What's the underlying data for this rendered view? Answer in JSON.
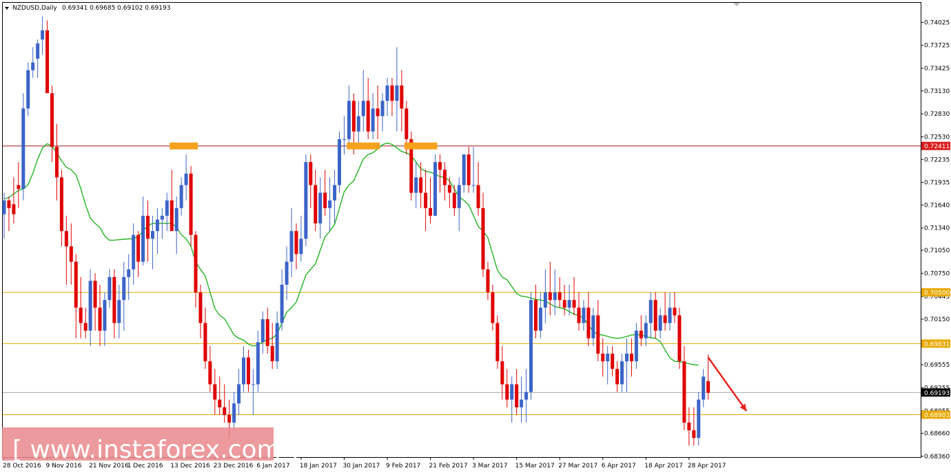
{
  "header": {
    "symbol": "NZDUSD,Daily",
    "ohlc": "0.69341 0.69685 0.69102 0.69193"
  },
  "watermark": {
    "text": "[ www.instaforex.com ]"
  },
  "colors": {
    "bull": "#3c64c8",
    "bear": "#e00000",
    "ma": "#22b522",
    "resistance_line": "#a01818",
    "level_line": "#e8a800",
    "current_line": "#aaaaaa",
    "marker": "#f6a21e",
    "arrow": "#e8241c",
    "watermark_bg": "#e9888c"
  },
  "chart_data": {
    "type": "candlestick",
    "symbol": "NZDUSD",
    "timeframe": "Daily",
    "ylim": [
      0.6835,
      0.7428
    ],
    "y_ticks": [
      "0.74025",
      "0.73725",
      "0.73425",
      "0.73130",
      "0.72830",
      "0.72530",
      "0.72235",
      "0.71935",
      "0.71640",
      "0.71340",
      "0.71050",
      "0.70750",
      "0.70445",
      "0.70150",
      "0.69555",
      "0.69255",
      "0.68955",
      "0.68660",
      "0.68360"
    ],
    "x_ticks": [
      {
        "label": "28 Oct 2016",
        "i": 0
      },
      {
        "label": "9 Nov 2016",
        "i": 9
      },
      {
        "label": "21 Nov 2016",
        "i": 18
      },
      {
        "label": "1 Dec 2016",
        "i": 26
      },
      {
        "label": "13 Dec 2016",
        "i": 35
      },
      {
        "label": "23 Dec 2016",
        "i": 44
      },
      {
        "label": "6 Jan 2017",
        "i": 53
      },
      {
        "label": "18 Jan 2017",
        "i": 62
      },
      {
        "label": "30 Jan 2017",
        "i": 71
      },
      {
        "label": "9 Feb 2017",
        "i": 80
      },
      {
        "label": "21 Feb 2017",
        "i": 89
      },
      {
        "label": "3 Mar 2017",
        "i": 98
      },
      {
        "label": "15 Mar 2017",
        "i": 107
      },
      {
        "label": "27 Mar 2017",
        "i": 116
      },
      {
        "label": "6 Apr 2017",
        "i": 125
      },
      {
        "label": "18 Apr 2017",
        "i": 134
      },
      {
        "label": "28 Apr 2017",
        "i": 143
      }
    ],
    "candles": [
      [
        0.7152,
        0.718,
        0.712,
        0.717
      ],
      [
        0.717,
        0.7175,
        0.713,
        0.716
      ],
      [
        0.7165,
        0.72,
        0.714,
        0.7152
      ],
      [
        0.719,
        0.722,
        0.716,
        0.7185
      ],
      [
        0.7185,
        0.731,
        0.717,
        0.729
      ],
      [
        0.729,
        0.735,
        0.728,
        0.734
      ],
      [
        0.734,
        0.737,
        0.733,
        0.735
      ],
      [
        0.7355,
        0.738,
        0.733,
        0.7375
      ],
      [
        0.738,
        0.741,
        0.736,
        0.7392
      ],
      [
        0.7392,
        0.7405,
        0.735,
        0.731
      ],
      [
        0.731,
        0.732,
        0.722,
        0.724
      ],
      [
        0.724,
        0.727,
        0.717,
        0.72
      ],
      [
        0.72,
        0.721,
        0.711,
        0.713
      ],
      [
        0.713,
        0.715,
        0.706,
        0.711
      ],
      [
        0.711,
        0.714,
        0.706,
        0.709
      ],
      [
        0.709,
        0.71,
        0.699,
        0.703
      ],
      [
        0.703,
        0.707,
        0.699,
        0.701
      ],
      [
        0.701,
        0.703,
        0.699,
        0.7
      ],
      [
        0.7,
        0.708,
        0.698,
        0.7065
      ],
      [
        0.7065,
        0.7075,
        0.7,
        0.703
      ],
      [
        0.703,
        0.706,
        0.698,
        0.7
      ],
      [
        0.7,
        0.705,
        0.698,
        0.704
      ],
      [
        0.704,
        0.708,
        0.703,
        0.707
      ],
      [
        0.707,
        0.708,
        0.699,
        0.701
      ],
      [
        0.701,
        0.706,
        0.699,
        0.704
      ],
      [
        0.704,
        0.709,
        0.7,
        0.707
      ],
      [
        0.707,
        0.71,
        0.704,
        0.708
      ],
      [
        0.708,
        0.714,
        0.706,
        0.7125
      ],
      [
        0.7125,
        0.713,
        0.707,
        0.709
      ],
      [
        0.709,
        0.7175,
        0.7085,
        0.715
      ],
      [
        0.715,
        0.717,
        0.709,
        0.712
      ],
      [
        0.712,
        0.715,
        0.708,
        0.713
      ],
      [
        0.713,
        0.716,
        0.71,
        0.7145
      ],
      [
        0.7145,
        0.716,
        0.712,
        0.715
      ],
      [
        0.715,
        0.718,
        0.713,
        0.717
      ],
      [
        0.717,
        0.721,
        0.714,
        0.713
      ],
      [
        0.713,
        0.7175,
        0.71,
        0.716
      ],
      [
        0.716,
        0.72,
        0.715,
        0.719
      ],
      [
        0.719,
        0.723,
        0.717,
        0.7205
      ],
      [
        0.7205,
        0.7215,
        0.711,
        0.7125
      ],
      [
        0.7125,
        0.713,
        0.703,
        0.705
      ],
      [
        0.705,
        0.706,
        0.699,
        0.701
      ],
      [
        0.701,
        0.703,
        0.695,
        0.696
      ],
      [
        0.696,
        0.698,
        0.692,
        0.693
      ],
      [
        0.693,
        0.695,
        0.689,
        0.691
      ],
      [
        0.691,
        0.694,
        0.689,
        0.69
      ],
      [
        0.69,
        0.693,
        0.688,
        0.689
      ],
      [
        0.689,
        0.691,
        0.686,
        0.688
      ],
      [
        0.688,
        0.692,
        0.687,
        0.6905
      ],
      [
        0.6905,
        0.695,
        0.689,
        0.693
      ],
      [
        0.693,
        0.698,
        0.692,
        0.6965
      ],
      [
        0.6965,
        0.6975,
        0.692,
        0.693
      ],
      [
        0.693,
        0.695,
        0.689,
        0.693
      ],
      [
        0.693,
        0.7,
        0.692,
        0.6985
      ],
      [
        0.6985,
        0.7025,
        0.697,
        0.7015
      ],
      [
        0.7015,
        0.703,
        0.697,
        0.698
      ],
      [
        0.698,
        0.701,
        0.695,
        0.696
      ],
      [
        0.696,
        0.7025,
        0.695,
        0.701
      ],
      [
        0.701,
        0.708,
        0.7,
        0.706
      ],
      [
        0.706,
        0.711,
        0.704,
        0.709
      ],
      [
        0.709,
        0.716,
        0.707,
        0.713
      ],
      [
        0.713,
        0.714,
        0.708,
        0.71
      ],
      [
        0.71,
        0.715,
        0.709,
        0.712
      ],
      [
        0.712,
        0.723,
        0.711,
        0.722
      ],
      [
        0.722,
        0.723,
        0.716,
        0.719
      ],
      [
        0.719,
        0.721,
        0.713,
        0.714
      ],
      [
        0.714,
        0.72,
        0.712,
        0.718
      ],
      [
        0.718,
        0.721,
        0.715,
        0.716
      ],
      [
        0.716,
        0.72,
        0.713,
        0.717
      ],
      [
        0.717,
        0.721,
        0.714,
        0.719
      ],
      [
        0.719,
        0.726,
        0.718,
        0.725
      ],
      [
        0.725,
        0.728,
        0.723,
        0.725
      ],
      [
        0.725,
        0.732,
        0.724,
        0.73
      ],
      [
        0.73,
        0.731,
        0.723,
        0.726
      ],
      [
        0.726,
        0.73,
        0.724,
        0.728
      ],
      [
        0.728,
        0.734,
        0.726,
        0.73
      ],
      [
        0.73,
        0.733,
        0.725,
        0.726
      ],
      [
        0.726,
        0.731,
        0.725,
        0.729
      ],
      [
        0.729,
        0.732,
        0.725,
        0.728
      ],
      [
        0.728,
        0.731,
        0.726,
        0.73
      ],
      [
        0.73,
        0.733,
        0.728,
        0.732
      ],
      [
        0.732,
        0.733,
        0.728,
        0.73
      ],
      [
        0.73,
        0.737,
        0.726,
        0.732
      ],
      [
        0.732,
        0.734,
        0.726,
        0.729
      ],
      [
        0.729,
        0.73,
        0.723,
        0.725
      ],
      [
        0.725,
        0.726,
        0.717,
        0.718
      ],
      [
        0.718,
        0.722,
        0.716,
        0.72
      ],
      [
        0.72,
        0.722,
        0.716,
        0.718
      ],
      [
        0.718,
        0.721,
        0.713,
        0.716
      ],
      [
        0.716,
        0.72,
        0.714,
        0.715
      ],
      [
        0.715,
        0.723,
        0.715,
        0.722
      ],
      [
        0.722,
        0.723,
        0.718,
        0.721
      ],
      [
        0.721,
        0.722,
        0.717,
        0.719
      ],
      [
        0.719,
        0.72,
        0.716,
        0.718
      ],
      [
        0.718,
        0.719,
        0.715,
        0.716
      ],
      [
        0.716,
        0.72,
        0.713,
        0.719
      ],
      [
        0.719,
        0.723,
        0.718,
        0.723
      ],
      [
        0.723,
        0.724,
        0.718,
        0.719
      ],
      [
        0.719,
        0.724,
        0.718,
        0.719
      ],
      [
        0.719,
        0.722,
        0.715,
        0.716
      ],
      [
        0.716,
        0.718,
        0.707,
        0.708
      ],
      [
        0.708,
        0.709,
        0.704,
        0.705
      ],
      [
        0.705,
        0.706,
        0.7,
        0.701
      ],
      [
        0.701,
        0.702,
        0.695,
        0.696
      ],
      [
        0.696,
        0.698,
        0.691,
        0.693
      ],
      [
        0.693,
        0.695,
        0.69,
        0.691
      ],
      [
        0.691,
        0.694,
        0.688,
        0.693
      ],
      [
        0.693,
        0.695,
        0.689,
        0.69
      ],
      [
        0.69,
        0.694,
        0.688,
        0.691
      ],
      [
        0.691,
        0.695,
        0.688,
        0.692
      ],
      [
        0.692,
        0.705,
        0.691,
        0.704
      ],
      [
        0.704,
        0.706,
        0.699,
        0.7
      ],
      [
        0.7,
        0.705,
        0.699,
        0.703
      ],
      [
        0.703,
        0.708,
        0.701,
        0.705
      ],
      [
        0.705,
        0.709,
        0.702,
        0.704
      ],
      [
        0.704,
        0.708,
        0.702,
        0.705
      ],
      [
        0.705,
        0.707,
        0.703,
        0.704
      ],
      [
        0.704,
        0.706,
        0.702,
        0.703
      ],
      [
        0.703,
        0.706,
        0.702,
        0.704
      ],
      [
        0.704,
        0.707,
        0.702,
        0.703
      ],
      [
        0.703,
        0.705,
        0.7,
        0.701
      ],
      [
        0.701,
        0.704,
        0.7,
        0.703
      ],
      [
        0.703,
        0.705,
        0.698,
        0.699
      ],
      [
        0.699,
        0.703,
        0.698,
        0.702
      ],
      [
        0.702,
        0.704,
        0.696,
        0.697
      ],
      [
        0.697,
        0.699,
        0.694,
        0.696
      ],
      [
        0.696,
        0.698,
        0.693,
        0.697
      ],
      [
        0.697,
        0.698,
        0.694,
        0.695
      ],
      [
        0.695,
        0.696,
        0.692,
        0.693
      ],
      [
        0.693,
        0.697,
        0.692,
        0.696
      ],
      [
        0.696,
        0.699,
        0.692,
        0.697
      ],
      [
        0.697,
        0.699,
        0.694,
        0.696
      ],
      [
        0.696,
        0.701,
        0.695,
        0.7
      ],
      [
        0.7,
        0.702,
        0.698,
        0.699
      ],
      [
        0.699,
        0.702,
        0.698,
        0.701
      ],
      [
        0.701,
        0.705,
        0.699,
        0.704
      ],
      [
        0.704,
        0.705,
        0.699,
        0.7
      ],
      [
        0.7,
        0.703,
        0.699,
        0.702
      ],
      [
        0.702,
        0.705,
        0.7,
        0.701
      ],
      [
        0.701,
        0.705,
        0.7,
        0.703
      ],
      [
        0.703,
        0.705,
        0.701,
        0.702
      ],
      [
        0.702,
        0.703,
        0.695,
        0.696
      ],
      [
        0.696,
        0.698,
        0.687,
        0.688
      ],
      [
        0.688,
        0.69,
        0.685,
        0.687
      ],
      [
        0.687,
        0.69,
        0.685,
        0.686
      ],
      [
        0.686,
        0.692,
        0.685,
        0.691
      ],
      [
        0.691,
        0.695,
        0.69,
        0.694
      ],
      [
        0.6934,
        0.6969,
        0.691,
        0.6919
      ]
    ],
    "moving_average": {
      "name": "",
      "keys": [
        [
          0,
          0.7172
        ],
        [
          4,
          0.7185
        ],
        [
          9,
          0.7244
        ],
        [
          14,
          0.721
        ],
        [
          19,
          0.714
        ],
        [
          22,
          0.7118
        ],
        [
          27,
          0.712
        ],
        [
          31,
          0.714
        ],
        [
          35,
          0.714
        ],
        [
          38,
          0.712
        ],
        [
          41,
          0.708
        ],
        [
          45,
          0.702
        ],
        [
          49,
          0.699
        ],
        [
          52,
          0.698
        ],
        [
          56,
          0.699
        ],
        [
          60,
          0.703
        ],
        [
          64,
          0.708
        ],
        [
          68,
          0.713
        ],
        [
          72,
          0.719
        ],
        [
          76,
          0.723
        ],
        [
          80,
          0.7245
        ],
        [
          84,
          0.7232
        ],
        [
          88,
          0.7208
        ],
        [
          92,
          0.72
        ],
        [
          96,
          0.717
        ],
        [
          100,
          0.713
        ],
        [
          104,
          0.707
        ],
        [
          108,
          0.7045
        ],
        [
          112,
          0.704
        ],
        [
          116,
          0.703
        ],
        [
          120,
          0.702
        ],
        [
          124,
          0.6995
        ],
        [
          128,
          0.699
        ],
        [
          132,
          0.6995
        ],
        [
          136,
          0.699
        ],
        [
          140,
          0.696
        ],
        [
          145,
          0.6955
        ]
      ]
    },
    "horizontal_levels": [
      {
        "value": 0.72411,
        "label": "0.72411",
        "kind": "resistance"
      },
      {
        "value": 0.705,
        "label": "0.70500",
        "kind": "level"
      },
      {
        "value": 0.69831,
        "label": "0.69831",
        "kind": "level"
      },
      {
        "value": 0.69193,
        "label": "0.69193",
        "kind": "current"
      },
      {
        "value": 0.68903,
        "label": "0.68903",
        "kind": "level"
      }
    ],
    "highlight_zones": [
      {
        "i_from": 35,
        "i_to": 40,
        "value": 0.72411
      },
      {
        "i_from": 72,
        "i_to": 78,
        "value": 0.72411
      },
      {
        "i_from": 84,
        "i_to": 90,
        "value": 0.72411
      }
    ],
    "forecast_arrow": {
      "from": [
        147,
        0.6965
      ],
      "to": [
        155,
        0.6895
      ],
      "direction": "down"
    }
  }
}
